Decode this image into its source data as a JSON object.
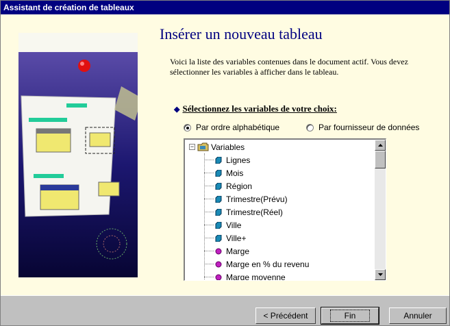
{
  "window": {
    "title": "Assistant de création de tableaux"
  },
  "main": {
    "heading": "Insérer un nouveau tableau",
    "description": "Voici la liste des variables contenues dans le document actif. Vous devez sélectionner les variables à afficher dans le tableau.",
    "select_title": "Sélectionnez les variables de votre choix:",
    "radio_alpha": "Par ordre alphabétique",
    "radio_provider": "Par fournisseur de données",
    "radio_selected": "alpha"
  },
  "tree": {
    "root_label": "Variables",
    "items": [
      {
        "label": "Lignes",
        "type": "dimension"
      },
      {
        "label": "Mois",
        "type": "dimension"
      },
      {
        "label": "Région",
        "type": "dimension"
      },
      {
        "label": "Trimestre(Prévu)",
        "type": "dimension"
      },
      {
        "label": "Trimestre(Réel)",
        "type": "dimension"
      },
      {
        "label": "Ville",
        "type": "dimension"
      },
      {
        "label": "Ville+",
        "type": "dimension"
      },
      {
        "label": "Marge",
        "type": "measure"
      },
      {
        "label": "Marge en % du revenu",
        "type": "measure"
      },
      {
        "label": "Marge moyenne",
        "type": "measure"
      }
    ]
  },
  "buttons": {
    "back": "< Précédent",
    "finish": "Fin",
    "cancel": "Annuler"
  },
  "colors": {
    "title_bar": "#000080",
    "panel_bg": "#fffce2",
    "dimension_icon": "#1a8ab5",
    "measure_icon": "#c020c0"
  }
}
